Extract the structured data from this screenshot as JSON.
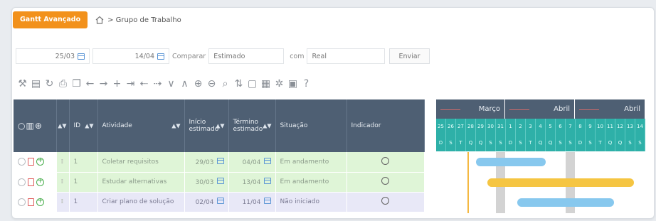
{
  "header": {
    "gantt_button": "Gantt Avançado",
    "breadcrumb": "> Grupo de Trabalho"
  },
  "filters": {
    "start": "25/03",
    "end": "14/04",
    "compare_label": "Comparar",
    "compare_value": "Estimado",
    "with_label": "com",
    "with_value": "Real",
    "send": "Enviar"
  },
  "toolbar_icons": [
    "wrench-icon",
    "file-icon",
    "refresh-icon",
    "print-icon",
    "copy-icon",
    "arrow-left-icon",
    "arrow-right-icon",
    "plus-icon",
    "indent-icon",
    "outdent-left-icon",
    "outdent-right-icon",
    "chevron-down-icon",
    "chevron-up-icon",
    "zoom-in-icon",
    "zoom-out-icon",
    "search-icon",
    "sort-icon",
    "columns-icon",
    "grid-icon",
    "gear-icon",
    "lock-icon",
    "help-icon"
  ],
  "table": {
    "headers": {
      "id": "ID",
      "activity": "Atividade",
      "start": "Início estimado",
      "end": "Término estimado",
      "status": "Situação",
      "indicator": "Indicador"
    },
    "rows": [
      {
        "id": "1",
        "activity": "Coletar requisitos",
        "start": "29/03",
        "end": "04/04",
        "status": "Em andamento",
        "color": "#dff5d7"
      },
      {
        "id": "1",
        "activity": "Estudar alternativas",
        "start": "30/03",
        "end": "13/04",
        "status": "Em andamento",
        "color": "#dff5d7"
      },
      {
        "id": "1",
        "activity": "Criar plano de solução",
        "start": "02/04",
        "end": "11/04",
        "status": "Não iniciado",
        "color": "#e8e8f7"
      }
    ]
  },
  "gantt": {
    "months": [
      "Março",
      "Abril",
      "Abril"
    ],
    "days": [
      "25",
      "26",
      "27",
      "28",
      "29",
      "30",
      "31",
      "1",
      "2",
      "3",
      "4",
      "5",
      "6",
      "7",
      "8",
      "9",
      "10",
      "11",
      "12",
      "13",
      "14"
    ],
    "weekdays": [
      "D",
      "S",
      "T",
      "Q",
      "Q",
      "S",
      "S",
      "D",
      "S",
      "T",
      "Q",
      "Q",
      "S",
      "S",
      "D",
      "S",
      "T",
      "Q",
      "Q",
      "S",
      "S"
    ],
    "bar_colors": [
      "#87c8ee",
      "#f5c542",
      "#87c8ee"
    ]
  }
}
